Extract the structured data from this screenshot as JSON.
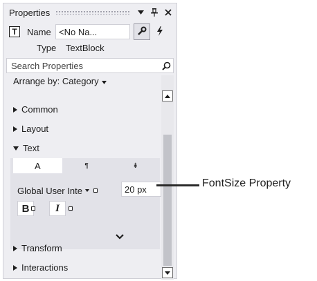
{
  "panel": {
    "title": "Properties",
    "name_label": "Name",
    "name_value": "<No Na...",
    "type_label": "Type",
    "type_value": "TextBlock",
    "search_placeholder": "Search Properties",
    "arrange_label": "Arrange by: Category",
    "categories": {
      "common": "Common",
      "layout": "Layout",
      "text": "Text",
      "transform": "Transform",
      "interactions": "Interactions"
    },
    "text_tabs": [
      "A",
      "¶",
      "⇟"
    ],
    "font_family": "Global User Inte",
    "font_size": "20 px",
    "bold": "B",
    "italic": "I"
  },
  "callout": {
    "label": "FontSize Property"
  },
  "icons": {
    "pin": "pin-icon",
    "close": "close-icon",
    "dropdown": "dropdown-icon",
    "wrench": "wrench-icon",
    "lightning": "lightning-icon",
    "search": "search-icon",
    "chevron": "chevron-down-icon",
    "textblock": "textblock-icon"
  },
  "colors": {
    "panel_bg": "#eeeef2",
    "section_bg": "#e2e2e8",
    "border": "#cfcfd6",
    "scroll_thumb": "#c2c3c9"
  }
}
